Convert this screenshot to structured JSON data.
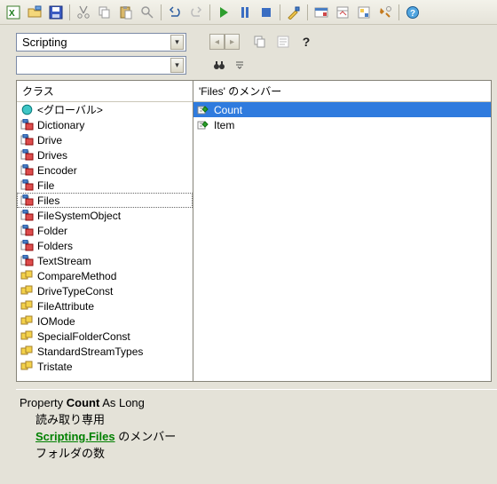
{
  "toolbar": {
    "icons": [
      "excel-doc-icon",
      "open-icon",
      "save-icon",
      "sep",
      "cut-icon",
      "copy-icon",
      "paste-icon",
      "find-icon",
      "sep",
      "undo-icon",
      "redo-icon",
      "sep",
      "run-icon",
      "pause-icon",
      "stop-icon",
      "sep",
      "design-icon",
      "sep",
      "project-icon",
      "properties-icon",
      "object-icon",
      "toolbox-icon",
      "sep",
      "help-icon"
    ]
  },
  "library_combo": {
    "value": "Scripting"
  },
  "search_combo": {
    "value": ""
  },
  "nav": {
    "back": "◂",
    "forward": "▸"
  },
  "row1_icons": [
    "copy-def-icon",
    "view-def-icon",
    "help-icon-q"
  ],
  "row2_icons": [
    "binoculars-icon",
    "options-icon"
  ],
  "classes": {
    "header": "クラス",
    "items": [
      {
        "icon": "globe",
        "label": "<グローバル>"
      },
      {
        "icon": "class",
        "label": "Dictionary"
      },
      {
        "icon": "class",
        "label": "Drive"
      },
      {
        "icon": "class",
        "label": "Drives"
      },
      {
        "icon": "class",
        "label": "Encoder"
      },
      {
        "icon": "class",
        "label": "File"
      },
      {
        "icon": "class",
        "label": "Files",
        "selected": true
      },
      {
        "icon": "class",
        "label": "FileSystemObject"
      },
      {
        "icon": "class",
        "label": "Folder"
      },
      {
        "icon": "class",
        "label": "Folders"
      },
      {
        "icon": "class",
        "label": "TextStream"
      },
      {
        "icon": "enum",
        "label": "CompareMethod"
      },
      {
        "icon": "enum",
        "label": "DriveTypeConst"
      },
      {
        "icon": "enum",
        "label": "FileAttribute"
      },
      {
        "icon": "enum",
        "label": "IOMode"
      },
      {
        "icon": "enum",
        "label": "SpecialFolderConst"
      },
      {
        "icon": "enum",
        "label": "StandardStreamTypes"
      },
      {
        "icon": "enum",
        "label": "Tristate"
      }
    ]
  },
  "members": {
    "header": "'Files' のメンバー",
    "items": [
      {
        "icon": "prop",
        "label": "Count",
        "highlight": true
      },
      {
        "icon": "prop",
        "label": "Item"
      }
    ]
  },
  "detail": {
    "sig_prefix": "Property ",
    "sig_name": "Count",
    "sig_suffix": " As Long",
    "readonly": "読み取り専用",
    "member_link": "Scripting.Files",
    "member_suffix": " のメンバー",
    "desc": "フォルダの数"
  }
}
